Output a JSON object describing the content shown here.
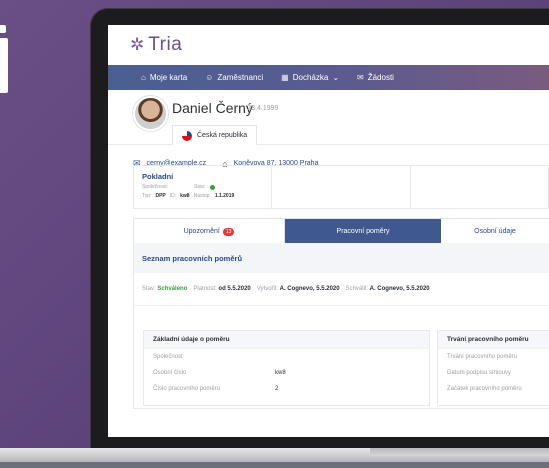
{
  "app": {
    "name": "Tria"
  },
  "nav": [
    {
      "icon": "home-icon",
      "label": "Moje karta"
    },
    {
      "icon": "people-icon",
      "label": "Zaměstnanci"
    },
    {
      "icon": "calendar-icon",
      "label": "Docházka"
    },
    {
      "icon": "mail-icon",
      "label": "Žádosti"
    }
  ],
  "profile": {
    "name": "Daniel Černý",
    "dob": "- 23.4.1999",
    "country": "Česká republika",
    "email": "cerny@example.cz",
    "address": "Koněvova 87, 13000 Praha"
  },
  "card": {
    "title": "Pokladní",
    "company_label": "Společnost:",
    "status_label": "Stav:",
    "type_label": "Typ:",
    "type_value": "DPP",
    "id_label": "ID:",
    "id_value": "kw8",
    "start_label": "Nástup:",
    "start_value": "1.1.2019"
  },
  "tabs": {
    "alerts": "Upozornění",
    "alerts_count": "13",
    "employment": "Pracovní poměry",
    "personal": "Osobní údaje"
  },
  "section": {
    "title": "Seznam pracovních poměrů",
    "status_label": "Stav:",
    "status_value": "Schváleno",
    "validity_label": "Platnost:",
    "validity_value": "od 5.5.2020",
    "created_label": "Vytvořil:",
    "created_value": "A. Cognevo, 5.5.2020",
    "approved_label": "Schválil:",
    "approved_value": "A. Cognevo, 5.5.2020"
  },
  "basic": {
    "title": "Základní údaje o poměru",
    "rows": [
      {
        "label": "Společnost",
        "value": ""
      },
      {
        "label": "Osobní číslo",
        "value": "kw8"
      },
      {
        "label": "Číslo pracovního poměru",
        "value": "2"
      }
    ]
  },
  "duration": {
    "title": "Trvání pracovního poměru",
    "rows": [
      {
        "label": "Trvání pracovního poměru"
      },
      {
        "label": "Datum podpisu smlouvy"
      },
      {
        "label": "Začátek pracovního poměru"
      }
    ]
  }
}
